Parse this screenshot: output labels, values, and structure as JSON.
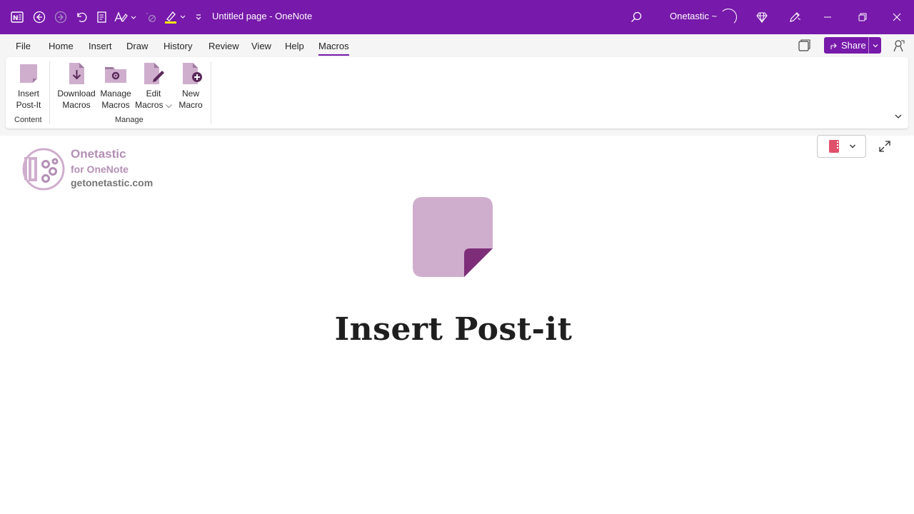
{
  "window": {
    "title": "Untitled page  -  OneNote",
    "account": "Onetastic ~"
  },
  "menu": {
    "tabs": [
      "File",
      "Home",
      "Insert",
      "Draw",
      "History",
      "Review",
      "View",
      "Help",
      "Macros"
    ],
    "active_tab": "Macros",
    "share_label": "Share"
  },
  "ribbon": {
    "groups": [
      {
        "label": "Content",
        "buttons": [
          {
            "line1": "Insert",
            "line2": "Post-It"
          }
        ]
      },
      {
        "label": "Manage",
        "buttons": [
          {
            "line1": "Download",
            "line2": "Macros"
          },
          {
            "line1": "Manage",
            "line2": "Macros"
          },
          {
            "line1": "Edit",
            "line2": "Macros ⌵"
          },
          {
            "line1": "New",
            "line2": "Macro"
          }
        ]
      }
    ]
  },
  "page": {
    "brand_name": "Onetastic",
    "brand_sub": "for OneNote",
    "brand_site": "getonetastic.com",
    "headline": "Insert Post-it"
  },
  "colors": {
    "accent": "#7719aa",
    "postit": "#cfaecd",
    "postit_fold": "#7e2e78"
  },
  "icons": [
    "onenote-app-icon",
    "back-icon",
    "forward-icon",
    "undo-icon",
    "page-icon",
    "ink-to-text-icon",
    "lasso-icon",
    "highlighter-icon",
    "customize-icon",
    "search-icon",
    "diamond-icon",
    "pen-icon",
    "minimize-icon",
    "restore-icon",
    "close-icon",
    "notebook-icon",
    "expand-icon"
  ]
}
